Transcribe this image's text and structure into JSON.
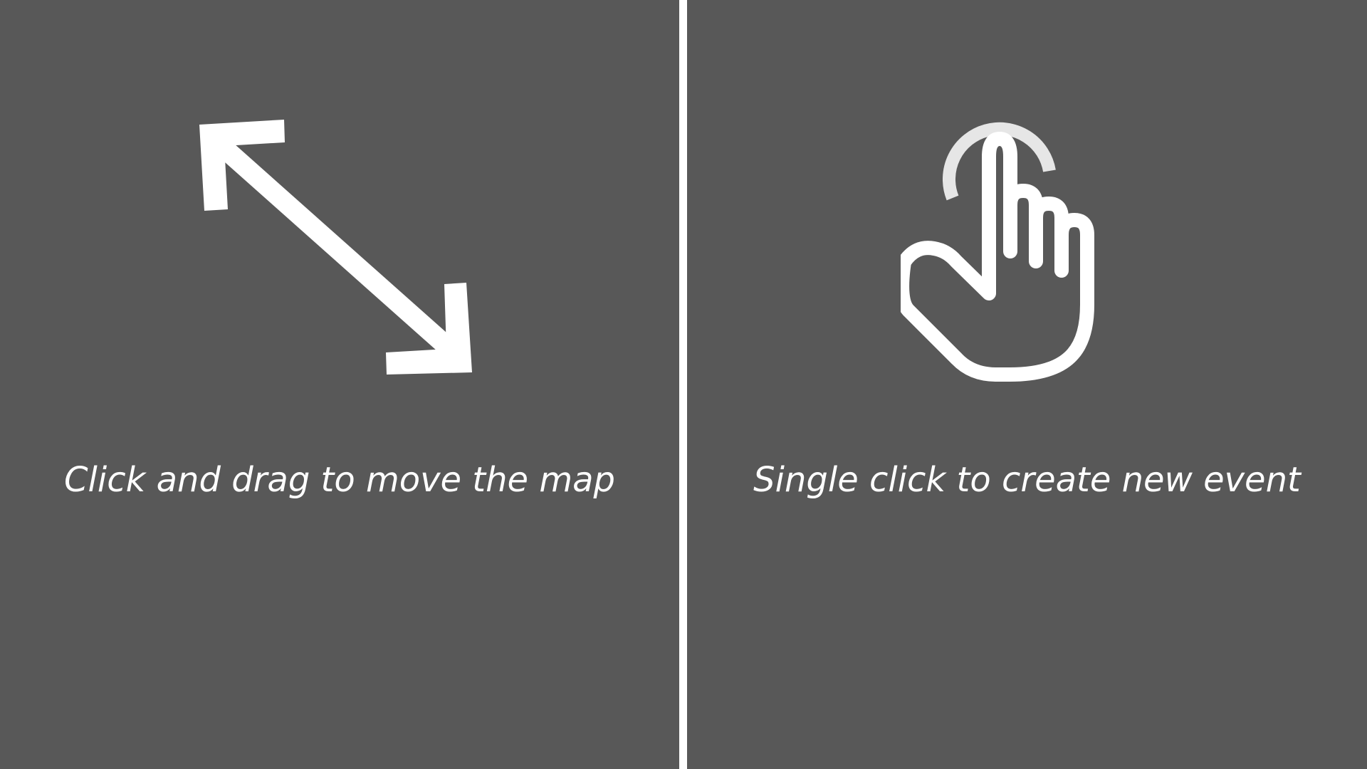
{
  "hints": {
    "drag": {
      "icon": "move-arrows-icon",
      "text": "Click and drag to move the map"
    },
    "click": {
      "icon": "pointer-hand-icon",
      "text": "Single click to create new event"
    }
  },
  "colors": {
    "panel_background": "#585858",
    "divider": "#ffffff",
    "foreground": "#ffffff",
    "tap_ring": "#e6e6e6"
  }
}
